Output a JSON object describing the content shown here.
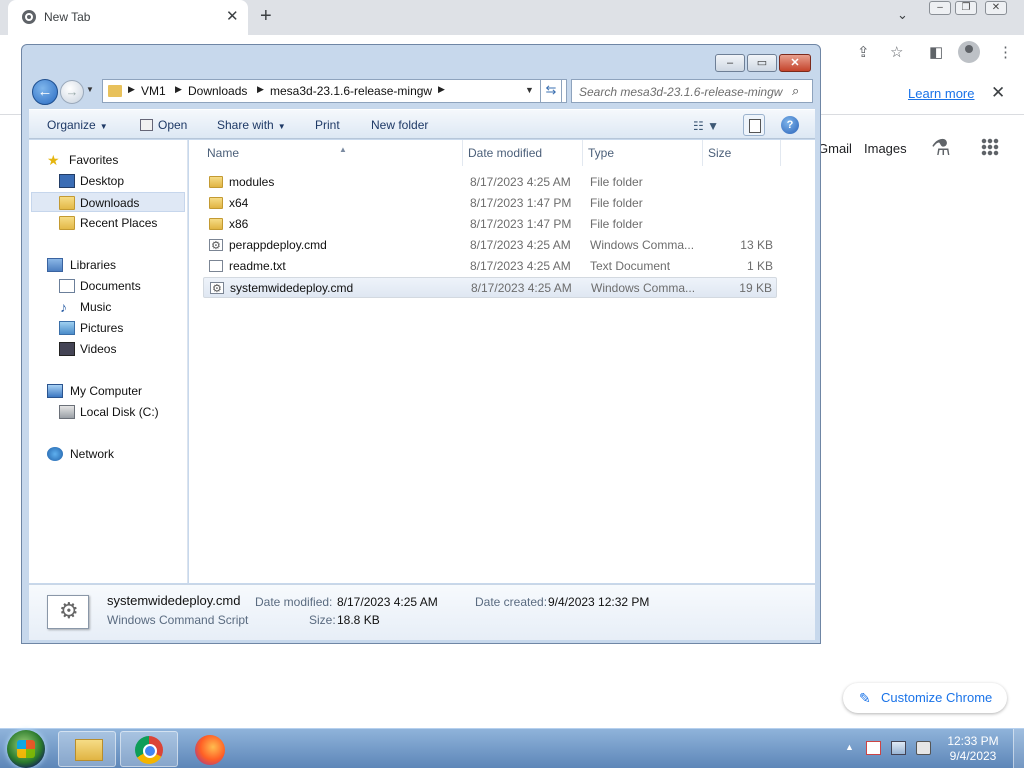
{
  "browser": {
    "tab_title": "New Tab",
    "infobar_link": "Learn more",
    "ntp_links": [
      "Gmail",
      "Images"
    ],
    "customize_label": "Customize Chrome"
  },
  "explorer": {
    "breadcrumb": [
      "VM1",
      "Downloads",
      "mesa3d-23.1.6-release-mingw"
    ],
    "search_placeholder": "Search mesa3d-23.1.6-release-mingw",
    "toolbar": {
      "organize": "Organize",
      "open": "Open",
      "share_with": "Share with",
      "print": "Print",
      "new_folder": "New folder"
    },
    "nav": {
      "favorites": "Favorites",
      "desktop": "Desktop",
      "downloads": "Downloads",
      "recent_places": "Recent Places",
      "libraries": "Libraries",
      "documents": "Documents",
      "music": "Music",
      "pictures": "Pictures",
      "videos": "Videos",
      "my_computer": "My Computer",
      "local_disk": "Local Disk (C:)",
      "network": "Network"
    },
    "columns": {
      "name": "Name",
      "date": "Date modified",
      "type": "Type",
      "size": "Size"
    },
    "files": [
      {
        "name": "modules",
        "date": "8/17/2023 4:25 AM",
        "type": "File folder",
        "size": ""
      },
      {
        "name": "x64",
        "date": "8/17/2023 1:47 PM",
        "type": "File folder",
        "size": ""
      },
      {
        "name": "x86",
        "date": "8/17/2023 1:47 PM",
        "type": "File folder",
        "size": ""
      },
      {
        "name": "perappdeploy.cmd",
        "date": "8/17/2023 4:25 AM",
        "type": "Windows Comma...",
        "size": "13 KB"
      },
      {
        "name": "readme.txt",
        "date": "8/17/2023 4:25 AM",
        "type": "Text Document",
        "size": "1 KB"
      },
      {
        "name": "systemwidedeploy.cmd",
        "date": "8/17/2023 4:25 AM",
        "type": "Windows Comma...",
        "size": "19 KB"
      }
    ],
    "details": {
      "name": "systemwidedeploy.cmd",
      "type": "Windows Command Script",
      "date_modified_label": "Date modified:",
      "date_modified": "8/17/2023 4:25 AM",
      "date_created_label": "Date created:",
      "date_created": "9/4/2023 12:32 PM",
      "size_label": "Size:",
      "size": "18.8 KB"
    }
  },
  "taskbar": {
    "time": "12:33 PM",
    "date": "9/4/2023"
  },
  "colors": {
    "link_blue": "#1a73e8",
    "selection": "#dfe8f5",
    "taskbar": "#5d86b8"
  }
}
